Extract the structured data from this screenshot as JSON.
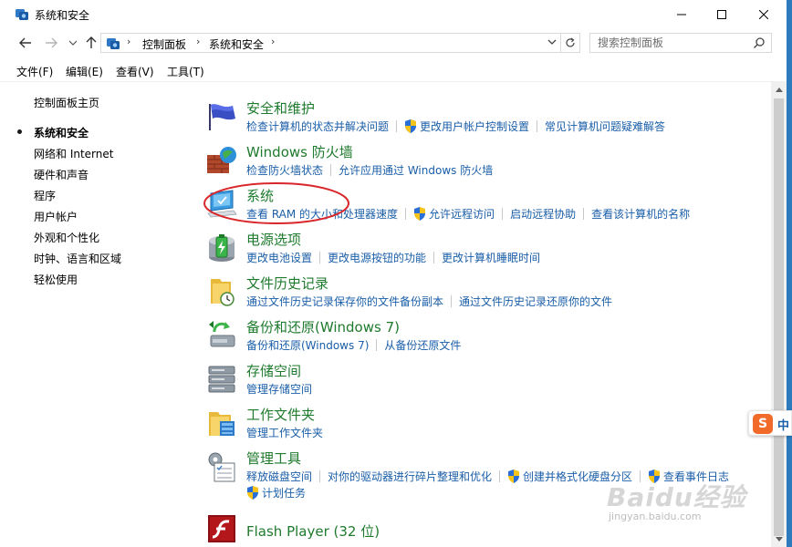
{
  "window": {
    "title": "系统和安全"
  },
  "address_bar": {
    "crumbs": [
      "控制面板",
      "系统和安全"
    ],
    "search_placeholder": "搜索控制面板"
  },
  "menu": [
    "文件(F)",
    "编辑(E)",
    "查看(V)",
    "工具(T)"
  ],
  "sidebar": {
    "items": [
      {
        "label": "控制面板主页"
      },
      {
        "label": "系统和安全",
        "current": true
      },
      {
        "label": "网络和 Internet"
      },
      {
        "label": "硬件和声音"
      },
      {
        "label": "程序"
      },
      {
        "label": "用户帐户"
      },
      {
        "label": "外观和个性化"
      },
      {
        "label": "时钟、语言和区域"
      },
      {
        "label": "轻松使用"
      }
    ]
  },
  "categories": [
    {
      "title": "安全和维护",
      "icon": "security-flag-icon",
      "links": [
        {
          "label": "检查计算机的状态并解决问题"
        },
        {
          "label": "更改用户帐户控制设置",
          "shield": true
        },
        {
          "label": "常见计算机问题疑难解答"
        }
      ]
    },
    {
      "title": "Windows 防火墙",
      "icon": "firewall-icon",
      "links": [
        {
          "label": "检查防火墙状态"
        },
        {
          "label": "允许应用通过 Windows 防火墙"
        }
      ]
    },
    {
      "title": "系统",
      "icon": "system-computer-icon",
      "links": [
        {
          "label": "查看 RAM 的大小和处理器速度"
        },
        {
          "label": "允许远程访问",
          "shield": true
        },
        {
          "label": "启动远程协助"
        },
        {
          "label": "查看该计算机的名称"
        }
      ]
    },
    {
      "title": "电源选项",
      "icon": "power-battery-icon",
      "links": [
        {
          "label": "更改电池设置"
        },
        {
          "label": "更改电源按钮的功能"
        },
        {
          "label": "更改计算机睡眠时间"
        }
      ]
    },
    {
      "title": "文件历史记录",
      "icon": "file-history-icon",
      "links": [
        {
          "label": "通过文件历史记录保存你的文件备份副本"
        },
        {
          "label": "通过文件历史记录还原你的文件"
        }
      ]
    },
    {
      "title": "备份和还原(Windows 7)",
      "icon": "backup-restore-icon",
      "links": [
        {
          "label": "备份和还原(Windows 7)"
        },
        {
          "label": "从备份还原文件"
        }
      ]
    },
    {
      "title": "存储空间",
      "icon": "storage-spaces-icon",
      "links": [
        {
          "label": "管理存储空间"
        }
      ]
    },
    {
      "title": "工作文件夹",
      "icon": "work-folders-icon",
      "links": [
        {
          "label": "管理工作文件夹"
        }
      ]
    },
    {
      "title": "管理工具",
      "icon": "admin-tools-icon",
      "links": [
        {
          "label": "释放磁盘空间"
        },
        {
          "label": "对你的驱动器进行碎片整理和优化"
        },
        {
          "label": "创建并格式化硬盘分区",
          "shield": true
        },
        {
          "label": "查看事件日志",
          "shield": true
        }
      ],
      "links_row2": [
        {
          "label": "计划任务",
          "shield": true
        }
      ]
    },
    {
      "title": "Flash Player (32 位)",
      "icon": "flash-player-icon",
      "links": []
    }
  ],
  "ime": {
    "logo": "S",
    "mode": "中"
  },
  "watermark": {
    "main": "Baidu经验",
    "url": "jingyan.baidu.com"
  },
  "colors": {
    "category_title": "#1e7a2c",
    "link": "#1a5ea8",
    "highlight_ring": "#d9262b"
  }
}
